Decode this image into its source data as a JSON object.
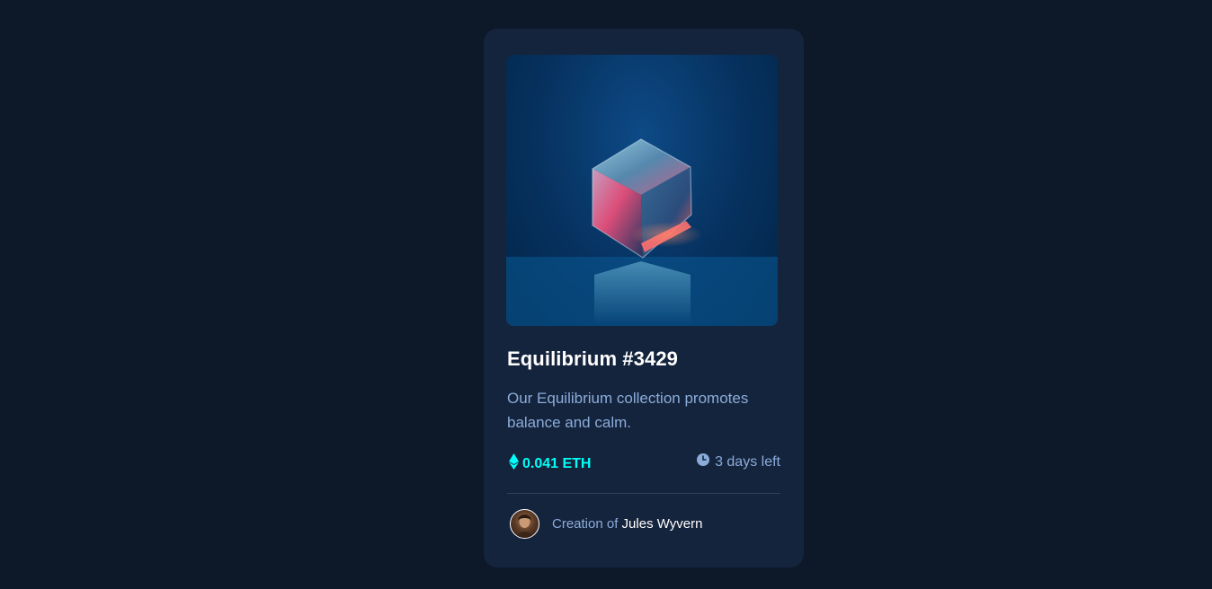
{
  "card": {
    "title": "Equilibrium #3429",
    "description": "Our Equilibrium collection promotes balance and calm.",
    "price": "0.041 ETH",
    "time_left": "3 days left",
    "creator_prefix": "Creation of",
    "creator_name": "Jules Wyvern"
  },
  "icons": {
    "price": "ethereum-icon",
    "time": "clock-icon"
  },
  "colors": {
    "page_bg": "#0d1829",
    "card_bg": "#15243d",
    "accent": "#00fff8",
    "soft_blue": "#8bacd9",
    "white": "#ffffff"
  }
}
